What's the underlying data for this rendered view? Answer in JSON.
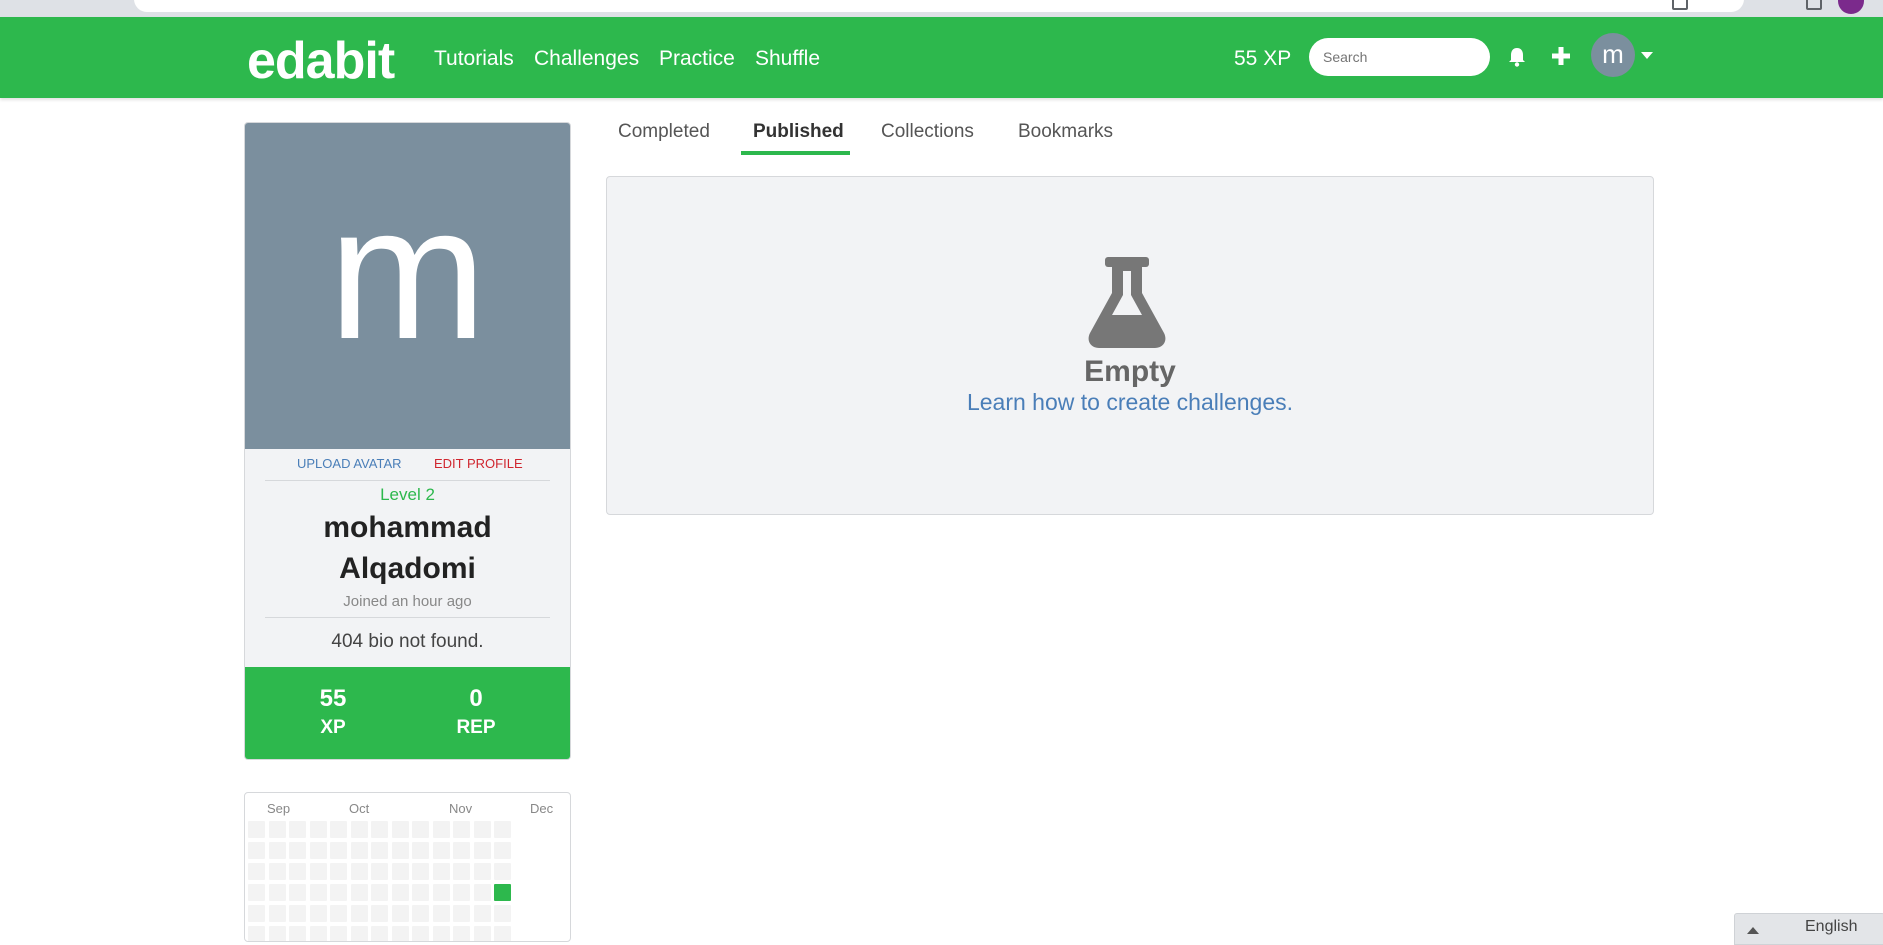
{
  "nav": {
    "logo": "edabit",
    "links": [
      "Tutorials",
      "Challenges",
      "Practice",
      "Shuffle"
    ],
    "xp": "55 XP",
    "search_placeholder": "Search",
    "avatar_letter": "m"
  },
  "profile": {
    "avatar_letter": "m",
    "upload_avatar": "UPLOAD AVATAR",
    "edit_profile": "EDIT PROFILE",
    "level": "Level 2",
    "name_first": "mohammad",
    "name_last": "Alqadomi",
    "joined": "Joined an hour ago",
    "bio": "404 bio not found.",
    "stats": [
      {
        "value": "55",
        "label": "XP"
      },
      {
        "value": "0",
        "label": "REP"
      }
    ]
  },
  "activity": {
    "months": [
      "Sep",
      "Oct",
      "Nov",
      "Dec"
    ]
  },
  "tabs": [
    {
      "label": "Completed",
      "active": false
    },
    {
      "label": "Published",
      "active": true
    },
    {
      "label": "Collections",
      "active": false
    },
    {
      "label": "Bookmarks",
      "active": false
    }
  ],
  "empty_state": {
    "icon": "flask-icon",
    "title": "Empty",
    "link": "Learn how to create challenges."
  },
  "language": {
    "label": "English"
  },
  "colors": {
    "brand_green": "#2db84d",
    "avatar_gray": "#7b8f9e",
    "link_blue": "#4a7eb8",
    "edit_red": "#d0262f"
  }
}
